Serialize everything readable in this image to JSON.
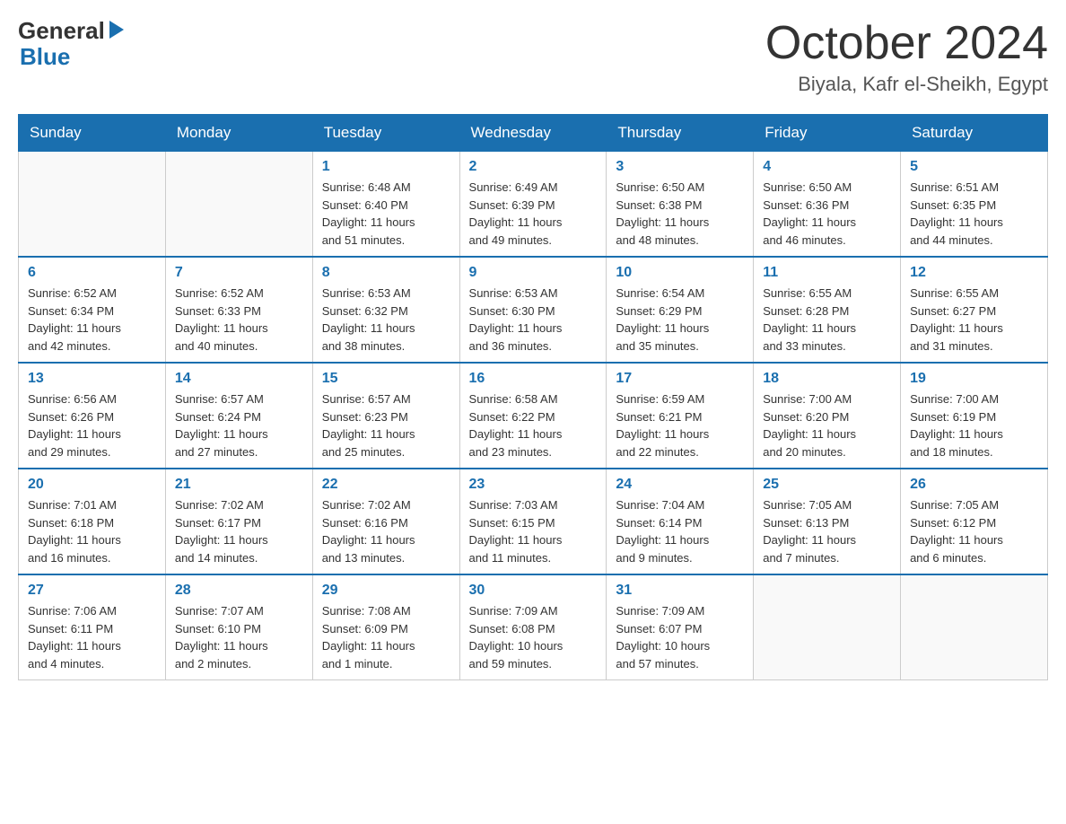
{
  "header": {
    "logo_general": "General",
    "logo_blue": "Blue",
    "month_title": "October 2024",
    "location": "Biyala, Kafr el-Sheikh, Egypt"
  },
  "calendar": {
    "headers": [
      "Sunday",
      "Monday",
      "Tuesday",
      "Wednesday",
      "Thursday",
      "Friday",
      "Saturday"
    ],
    "weeks": [
      [
        {
          "day": "",
          "info": ""
        },
        {
          "day": "",
          "info": ""
        },
        {
          "day": "1",
          "info": "Sunrise: 6:48 AM\nSunset: 6:40 PM\nDaylight: 11 hours\nand 51 minutes."
        },
        {
          "day": "2",
          "info": "Sunrise: 6:49 AM\nSunset: 6:39 PM\nDaylight: 11 hours\nand 49 minutes."
        },
        {
          "day": "3",
          "info": "Sunrise: 6:50 AM\nSunset: 6:38 PM\nDaylight: 11 hours\nand 48 minutes."
        },
        {
          "day": "4",
          "info": "Sunrise: 6:50 AM\nSunset: 6:36 PM\nDaylight: 11 hours\nand 46 minutes."
        },
        {
          "day": "5",
          "info": "Sunrise: 6:51 AM\nSunset: 6:35 PM\nDaylight: 11 hours\nand 44 minutes."
        }
      ],
      [
        {
          "day": "6",
          "info": "Sunrise: 6:52 AM\nSunset: 6:34 PM\nDaylight: 11 hours\nand 42 minutes."
        },
        {
          "day": "7",
          "info": "Sunrise: 6:52 AM\nSunset: 6:33 PM\nDaylight: 11 hours\nand 40 minutes."
        },
        {
          "day": "8",
          "info": "Sunrise: 6:53 AM\nSunset: 6:32 PM\nDaylight: 11 hours\nand 38 minutes."
        },
        {
          "day": "9",
          "info": "Sunrise: 6:53 AM\nSunset: 6:30 PM\nDaylight: 11 hours\nand 36 minutes."
        },
        {
          "day": "10",
          "info": "Sunrise: 6:54 AM\nSunset: 6:29 PM\nDaylight: 11 hours\nand 35 minutes."
        },
        {
          "day": "11",
          "info": "Sunrise: 6:55 AM\nSunset: 6:28 PM\nDaylight: 11 hours\nand 33 minutes."
        },
        {
          "day": "12",
          "info": "Sunrise: 6:55 AM\nSunset: 6:27 PM\nDaylight: 11 hours\nand 31 minutes."
        }
      ],
      [
        {
          "day": "13",
          "info": "Sunrise: 6:56 AM\nSunset: 6:26 PM\nDaylight: 11 hours\nand 29 minutes."
        },
        {
          "day": "14",
          "info": "Sunrise: 6:57 AM\nSunset: 6:24 PM\nDaylight: 11 hours\nand 27 minutes."
        },
        {
          "day": "15",
          "info": "Sunrise: 6:57 AM\nSunset: 6:23 PM\nDaylight: 11 hours\nand 25 minutes."
        },
        {
          "day": "16",
          "info": "Sunrise: 6:58 AM\nSunset: 6:22 PM\nDaylight: 11 hours\nand 23 minutes."
        },
        {
          "day": "17",
          "info": "Sunrise: 6:59 AM\nSunset: 6:21 PM\nDaylight: 11 hours\nand 22 minutes."
        },
        {
          "day": "18",
          "info": "Sunrise: 7:00 AM\nSunset: 6:20 PM\nDaylight: 11 hours\nand 20 minutes."
        },
        {
          "day": "19",
          "info": "Sunrise: 7:00 AM\nSunset: 6:19 PM\nDaylight: 11 hours\nand 18 minutes."
        }
      ],
      [
        {
          "day": "20",
          "info": "Sunrise: 7:01 AM\nSunset: 6:18 PM\nDaylight: 11 hours\nand 16 minutes."
        },
        {
          "day": "21",
          "info": "Sunrise: 7:02 AM\nSunset: 6:17 PM\nDaylight: 11 hours\nand 14 minutes."
        },
        {
          "day": "22",
          "info": "Sunrise: 7:02 AM\nSunset: 6:16 PM\nDaylight: 11 hours\nand 13 minutes."
        },
        {
          "day": "23",
          "info": "Sunrise: 7:03 AM\nSunset: 6:15 PM\nDaylight: 11 hours\nand 11 minutes."
        },
        {
          "day": "24",
          "info": "Sunrise: 7:04 AM\nSunset: 6:14 PM\nDaylight: 11 hours\nand 9 minutes."
        },
        {
          "day": "25",
          "info": "Sunrise: 7:05 AM\nSunset: 6:13 PM\nDaylight: 11 hours\nand 7 minutes."
        },
        {
          "day": "26",
          "info": "Sunrise: 7:05 AM\nSunset: 6:12 PM\nDaylight: 11 hours\nand 6 minutes."
        }
      ],
      [
        {
          "day": "27",
          "info": "Sunrise: 7:06 AM\nSunset: 6:11 PM\nDaylight: 11 hours\nand 4 minutes."
        },
        {
          "day": "28",
          "info": "Sunrise: 7:07 AM\nSunset: 6:10 PM\nDaylight: 11 hours\nand 2 minutes."
        },
        {
          "day": "29",
          "info": "Sunrise: 7:08 AM\nSunset: 6:09 PM\nDaylight: 11 hours\nand 1 minute."
        },
        {
          "day": "30",
          "info": "Sunrise: 7:09 AM\nSunset: 6:08 PM\nDaylight: 10 hours\nand 59 minutes."
        },
        {
          "day": "31",
          "info": "Sunrise: 7:09 AM\nSunset: 6:07 PM\nDaylight: 10 hours\nand 57 minutes."
        },
        {
          "day": "",
          "info": ""
        },
        {
          "day": "",
          "info": ""
        }
      ]
    ]
  }
}
